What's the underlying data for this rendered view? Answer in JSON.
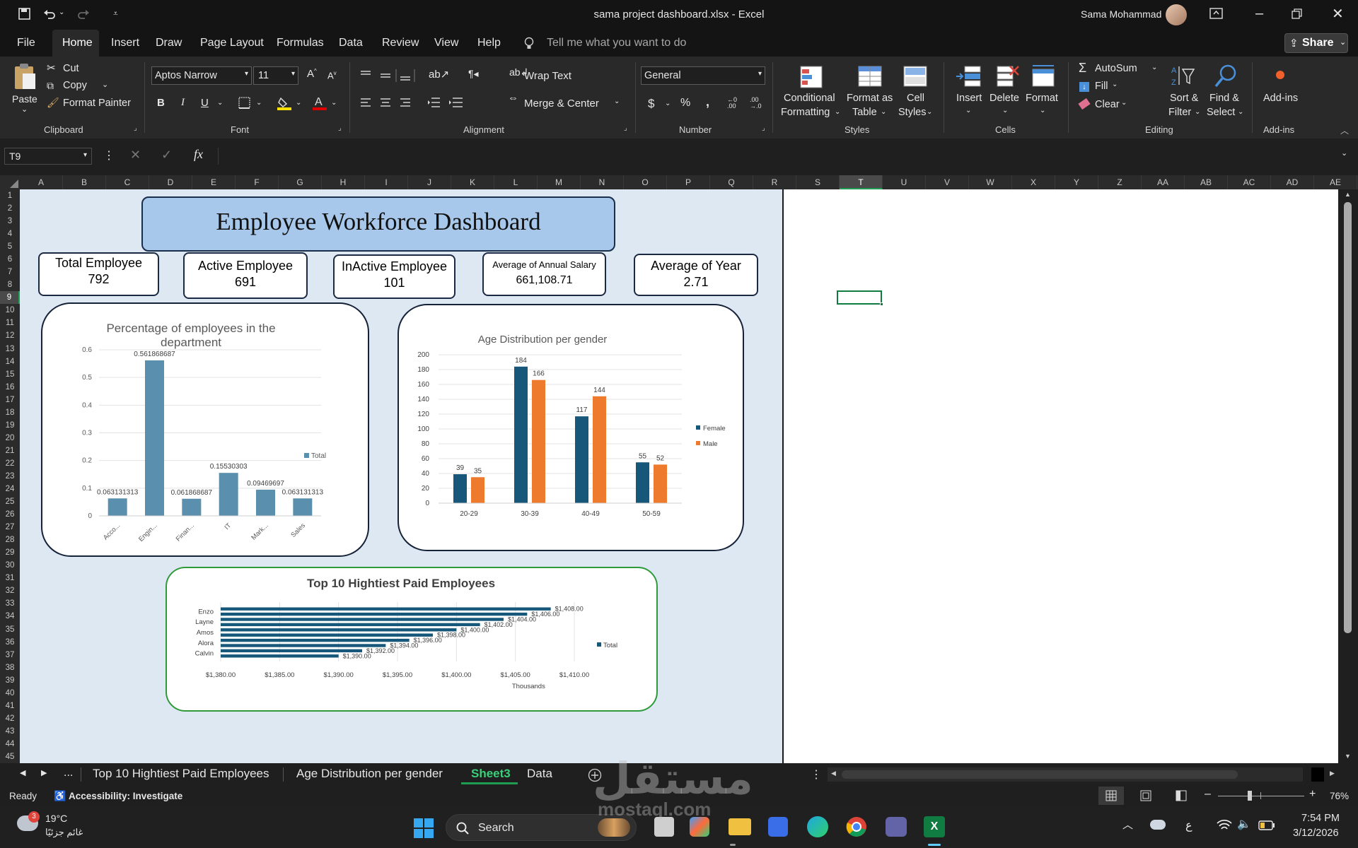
{
  "window": {
    "title": "sama project dashboard.xlsx  -  Excel",
    "user": "Sama Mohammad",
    "qat": [
      "save-icon",
      "undo-icon",
      "redo-icon",
      "customize-icon"
    ]
  },
  "menu": {
    "items": [
      "File",
      "Home",
      "Insert",
      "Draw",
      "Page Layout",
      "Formulas",
      "Data",
      "Review",
      "View",
      "Help"
    ],
    "active": "Home",
    "tell_me": "Tell me what you want to do",
    "share": "Share"
  },
  "ribbon": {
    "clipboard": {
      "paste": "Paste",
      "cut": "Cut",
      "copy": "Copy",
      "format_painter": "Format Painter",
      "group": "Clipboard"
    },
    "font": {
      "name": "Aptos Narrow",
      "size": "11",
      "group": "Font",
      "bold": "B",
      "italic": "I",
      "underline": "U"
    },
    "alignment": {
      "wrap": "Wrap Text",
      "merge": "Merge & Center",
      "group": "Alignment"
    },
    "number": {
      "format": "General",
      "group": "Number",
      "currency": "$",
      "percent": "%",
      "comma": ","
    },
    "styles": {
      "conditional": "Conditional",
      "conditional2": "Formatting",
      "format_table": "Format as",
      "format_table2": "Table",
      "cell_styles": "Cell",
      "cell_styles2": "Styles",
      "group": "Styles"
    },
    "cells": {
      "insert": "Insert",
      "delete": "Delete",
      "format": "Format",
      "group": "Cells"
    },
    "editing": {
      "autosum": "AutoSum",
      "fill": "Fill",
      "clear": "Clear",
      "sort": "Sort &",
      "sort2": "Filter",
      "find": "Find &",
      "find2": "Select",
      "group": "Editing"
    },
    "addins": {
      "label": "Add-ins",
      "group": "Add-ins"
    }
  },
  "formula_bar": {
    "name_box": "T9",
    "fx": "fx",
    "value": ""
  },
  "columns": [
    "A",
    "B",
    "C",
    "D",
    "E",
    "F",
    "G",
    "H",
    "I",
    "J",
    "K",
    "L",
    "M",
    "N",
    "O",
    "P",
    "Q",
    "R",
    "S",
    "T",
    "U",
    "V",
    "W",
    "X",
    "Y",
    "Z",
    "AA",
    "AB",
    "AC",
    "AD",
    "AE"
  ],
  "selected_column": "T",
  "rows_count": 45,
  "selected_row": 9,
  "dashboard": {
    "title": "Employee Workforce Dashboard",
    "kpis": [
      {
        "label": "Total Employee",
        "value": "792"
      },
      {
        "label": "Active Employee",
        "value": "691"
      },
      {
        "label": "InActive Employee",
        "value": "101"
      },
      {
        "label": "Average of Annual Salary",
        "value": "661,108.71"
      },
      {
        "label": "Average of Year",
        "value": "2.71"
      }
    ]
  },
  "chart_data": [
    {
      "type": "bar",
      "title": "Percentage of employees in the department",
      "categories": [
        "Acco...",
        "Engin...",
        "Finan...",
        "IT",
        "Mark...",
        "Sales"
      ],
      "series": [
        {
          "name": "Total",
          "values": [
            0.063131313,
            0.561868687,
            0.061868687,
            0.15530303,
            0.09469697,
            0.063131313
          ]
        }
      ],
      "labels": [
        "0.063131313",
        "0.561868687",
        "0.061868687",
        "0.15530303",
        "0.09469697",
        "0.063131313"
      ],
      "yticks": [
        "0",
        "0.1",
        "0.2",
        "0.3",
        "0.4",
        "0.5",
        "0.6"
      ],
      "ylim": [
        0,
        0.6
      ],
      "legend": "right",
      "color": "#5b8fae"
    },
    {
      "type": "bar",
      "title": "Age Distribution per gender",
      "categories": [
        "20-29",
        "30-39",
        "40-49",
        "50-59"
      ],
      "series": [
        {
          "name": "Female",
          "values": [
            39,
            184,
            117,
            55
          ],
          "color": "#16577a"
        },
        {
          "name": "Male",
          "values": [
            35,
            166,
            144,
            52
          ],
          "color": "#ee7a2e"
        }
      ],
      "yticks": [
        "0",
        "20",
        "40",
        "60",
        "80",
        "100",
        "120",
        "140",
        "160",
        "180",
        "200"
      ],
      "ylim": [
        0,
        200
      ],
      "legend": "right"
    },
    {
      "type": "bar",
      "orientation": "horizontal",
      "title": "Top 10 Hightiest Paid Employees",
      "category_labels": [
        "Enzo",
        "Layne",
        "Amos",
        "Alora",
        "Calvin"
      ],
      "series": [
        {
          "name": "Total",
          "values": [
            1408,
            1406,
            1404,
            1402,
            1400,
            1398,
            1396,
            1394,
            1392,
            1390
          ]
        }
      ],
      "labels": [
        "$1,408.00",
        "$1,406.00",
        "$1,404.00",
        "$1,402.00",
        "$1,400.00",
        "$1,398.00",
        "$1,396.00",
        "$1,394.00",
        "$1,392.00",
        "$1,390.00"
      ],
      "xticks": [
        "$1,380.00",
        "$1,385.00",
        "$1,390.00",
        "$1,395.00",
        "$1,400.00",
        "$1,405.00",
        "$1,410.00"
      ],
      "xlim": [
        1380,
        1410
      ],
      "xunit": "Thousands",
      "legend": "right",
      "color": "#16577a"
    }
  ],
  "sheet_tabs": {
    "ellipsis": "...",
    "tabs": [
      "Top 10 Hightiest Paid Employees",
      "Age Distribution per gender",
      "Sheet3",
      "Data"
    ],
    "active": "Sheet3"
  },
  "status": {
    "ready": "Ready",
    "accessibility": "Accessibility: Investigate",
    "zoom": "76%"
  },
  "taskbar": {
    "weather_temp": "19°C",
    "weather_desc": "غائم جزئيًا",
    "weather_badge": "3",
    "search": "Search",
    "lang": "ع",
    "time": "7:54 PM",
    "date": "3/12/2026"
  },
  "watermark": {
    "arabic": "مستقل",
    "latin": "mostaql.com"
  },
  "colors": {
    "accent": "#107c41",
    "dash_bg": "#dde8f3",
    "title_box": "#a7c8eb"
  }
}
